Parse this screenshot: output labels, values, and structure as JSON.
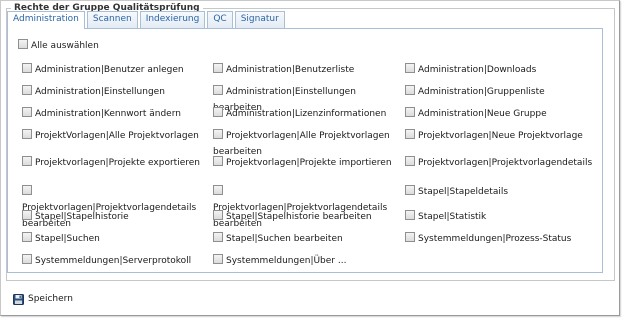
{
  "group": {
    "legend": "Rechte der Gruppe Qualitätsprüfung"
  },
  "tabs": [
    {
      "label": "Administration",
      "active": true
    },
    {
      "label": "Scannen",
      "active": false
    },
    {
      "label": "Indexierung",
      "active": false
    },
    {
      "label": "QC",
      "active": false
    },
    {
      "label": "Signatur",
      "active": false
    }
  ],
  "select_all": {
    "label": "Alle auswählen",
    "checked": false
  },
  "permissions": [
    [
      "Administration|Benutzer anlegen",
      "Administration|Benutzerliste",
      "Administration|Downloads"
    ],
    [
      "Administration|Einstellungen",
      "Administration|Einstellungen bearbeiten",
      "Administration|Gruppenliste"
    ],
    [
      "Administration|Kennwort ändern",
      "Administration|Lizenzinformationen",
      "Administration|Neue Gruppe"
    ],
    [
      "ProjektVorlagen|Alle Projektvorlagen",
      "Projektvorlagen|Alle Projektvorlagen bearbeiten",
      "Projektvorlagen|Neue Projektvorlage"
    ],
    [
      "Projektvorlagen|Projekte exportieren",
      "Projektvorlagen|Projekte importieren",
      "Projektvorlagen|Projektvorlagendetails"
    ],
    [
      "Projektvorlagen|Projektvorlagendetails bearbeiten",
      "Projektvorlagen|Projektvorlagendetails bearbeiten",
      "Stapel|Stapeldetails"
    ],
    [
      "Stapel|Stapelhistorie",
      "Stapel|Stapelhistorie bearbeiten",
      "Stapel|Statistik"
    ],
    [
      "Stapel|Suchen",
      "Stapel|Suchen bearbeiten",
      "Systemmeldungen|Prozess-Status"
    ],
    [
      "Systemmeldungen|Serverprotokoll",
      "Systemmeldungen|Über ...",
      ""
    ]
  ],
  "save": {
    "label": "Speichern",
    "icon": "floppy-disk-icon"
  },
  "colors": {
    "tab_text": "#2a65a6",
    "tab_border": "#a9bfd6"
  }
}
